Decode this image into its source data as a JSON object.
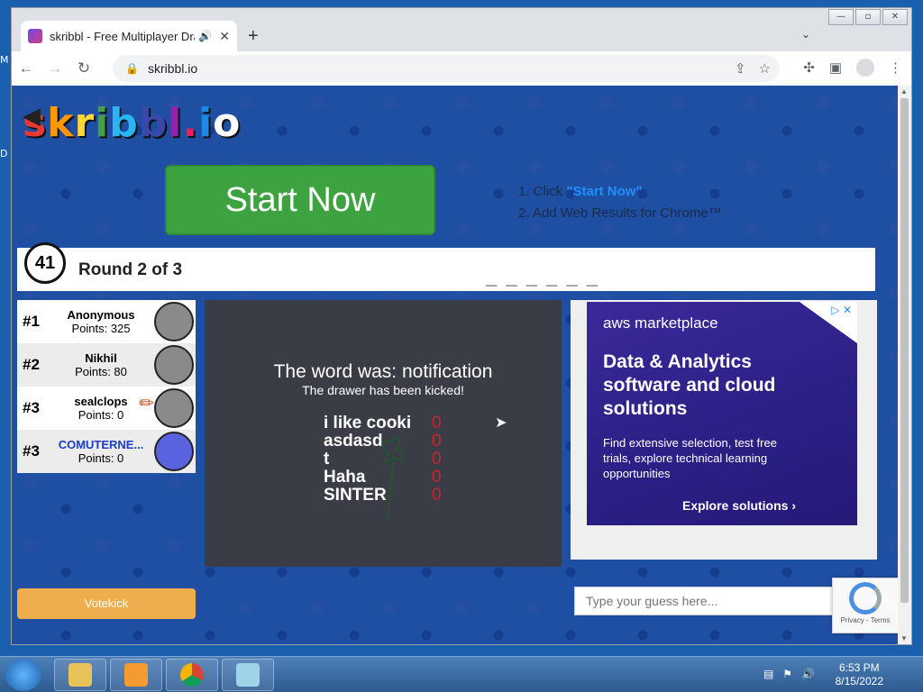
{
  "desktop": {
    "frag_top": "M",
    "frag_bottom": "D"
  },
  "browser": {
    "tab_title": "skribbl - Free Multiplayer Dra",
    "url": "skribbl.io"
  },
  "page": {
    "logo": [
      "s",
      "k",
      "r",
      "i",
      "b",
      "b",
      "l",
      ".",
      "i",
      "o"
    ],
    "logo_colors": [
      "#e53935",
      "#ff9800",
      "#fdd835",
      "#43a047",
      "#29b6f6",
      "#3949ab",
      "#8e24aa",
      "#e91e63",
      "#1e88e5",
      "#ffffff"
    ],
    "start_now": "Start Now",
    "ad_steps": {
      "line1_prefix": "1. Click ",
      "line1_link": "\"Start Now\"",
      "line2": "2. Add Web Results for Chrome™"
    },
    "timer": "41",
    "round": "Round 2 of 3",
    "word_hint": "_ _ _ _ _ _",
    "players": [
      {
        "rank": "#1",
        "name": "Anonymous",
        "points": "Points: 325",
        "me": false,
        "drawing": false
      },
      {
        "rank": "#2",
        "name": "Nikhil",
        "points": "Points: 80",
        "me": false,
        "drawing": false
      },
      {
        "rank": "#3",
        "name": "sealclops",
        "points": "Points: 0",
        "me": false,
        "drawing": true
      },
      {
        "rank": "#3",
        "name": "COMUTERNE...",
        "points": "Points: 0",
        "me": true,
        "drawing": false
      }
    ],
    "votekick": "Votekick",
    "canvas": {
      "reveal": "The word was: notification",
      "sub": "The drawer has been kicked!",
      "scores": [
        {
          "name": "i like cooki",
          "score": "0"
        },
        {
          "name": "asdasd",
          "score": "0"
        },
        {
          "name": "t",
          "score": "0"
        },
        {
          "name": "Haha",
          "score": "0"
        },
        {
          "name": "SINTER",
          "score": "0"
        }
      ]
    },
    "aws_ad": {
      "brand": "aws marketplace",
      "headline": "Data & Analytics software and cloud solutions",
      "body": "Find extensive selection, test free trials, explore technical learning opportunities",
      "cta": "Explore solutions ›"
    },
    "guess_placeholder": "Type your guess here...",
    "recaptcha": "Privacy - Terms"
  },
  "taskbar": {
    "time": "6:53 PM",
    "date": "8/15/2022"
  }
}
